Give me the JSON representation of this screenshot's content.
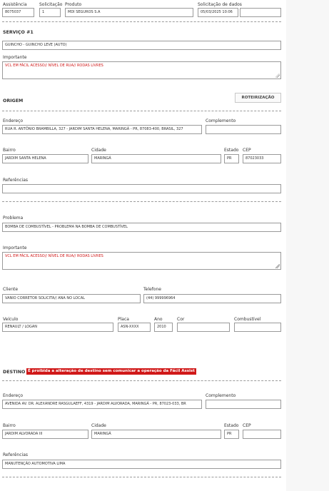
{
  "header": {
    "assistencia_label": "Assistência",
    "assistencia_value": "8075037",
    "solicitacao_label": "Solicitação",
    "solicitacao_value": "1",
    "produto_label": "Produto",
    "produto_value": "MDI SEGUROS S.A",
    "solicitacao_dados_label": "Solicitação de dados",
    "solicitacao_dados_value": "05/03/2025 10:06",
    "extra_value": ""
  },
  "servico": {
    "title": "SERVIÇO #1",
    "servico_value": "GUINCHO - GUINCHO LEVE (AUTO)",
    "importante_label": "Importante",
    "importante_value": "VCL EM FÁCIL ACESSO// NÍVEL DE RUA// RODAS LIVRES"
  },
  "origem": {
    "title": "ORIGEM",
    "roteirizacao_button": "ROTEIRIZAÇÃO",
    "endereco_label": "Endereço",
    "endereco_value": "RUA R. ANTÔNIO BRAMBILLA, 327 - JARDIM SANTA HELENA, MARINGÁ - PR, 87083-400, BRASIL, 327",
    "complemento_label": "Complemento",
    "complemento_value": "",
    "bairro_label": "Bairro",
    "bairro_value": "JARDIM SANTA HELENA",
    "cidade_label": "Cidade",
    "cidade_value": "MARINGÁ",
    "estado_label": "Estado",
    "estado_value": "PR",
    "cep_label": "CEP",
    "cep_value": "87023033",
    "referencias_label": "Referências",
    "referencias_value": ""
  },
  "problema": {
    "problema_label": "Problema",
    "problema_value": "BOMBA DE COMBUSTÍVEL - PROBLEMA NA BOMBA DE COMBUSTÍVEL",
    "importante_label": "Importante",
    "importante_value": "VCL EM FÁCIL ACESSO// NÍVEL DE RUA// RODAS LIVRES",
    "cliente_label": "Cliente",
    "cliente_value": "VANIO CORRETOR SOLICITA// ANA NO LOCAL",
    "telefone_label": "Telefone",
    "telefone_value": "(44) 999996964",
    "veiculo_label": "Veículo",
    "veiculo_value": "RENAULT / LOGAN",
    "placa_label": "Placa",
    "placa_value": "ASN-XXXX",
    "ano_label": "Ano",
    "ano_value": "2010",
    "cor_label": "Cor",
    "cor_value": "",
    "combustivel_label": "Combustível",
    "combustivel_value": ""
  },
  "destino": {
    "title": "DESTINO",
    "warning": "É proibida a alteração de destino sem comunicar a operação da Fácil Assist",
    "endereco_label": "Endereço",
    "endereco_value": "AVENIDA AV. DR. ALEXANDRE RASGULAEFF, 4319 - JARDIM ALVORADA, MARINGÁ - PR, 87023-033, BR",
    "complemento_label": "Complemento",
    "complemento_value": "",
    "bairro_label": "Bairro",
    "bairro_value": "JARDIM ALVORADA III",
    "cidade_label": "Cidade",
    "cidade_value": "MARINGÁ",
    "estado_label": "Estado",
    "estado_value": "PR",
    "cep_label": "CEP",
    "cep_value": "",
    "referencias_label": "Referências",
    "referencias_value": "MANUTENÇÃO AUTOMOTIVA  LIMA"
  },
  "colors": {
    "page_background": "#f7f7f7",
    "form_background": "#ffffff",
    "warning_background": "#d01818",
    "important_text": "#d01818"
  }
}
